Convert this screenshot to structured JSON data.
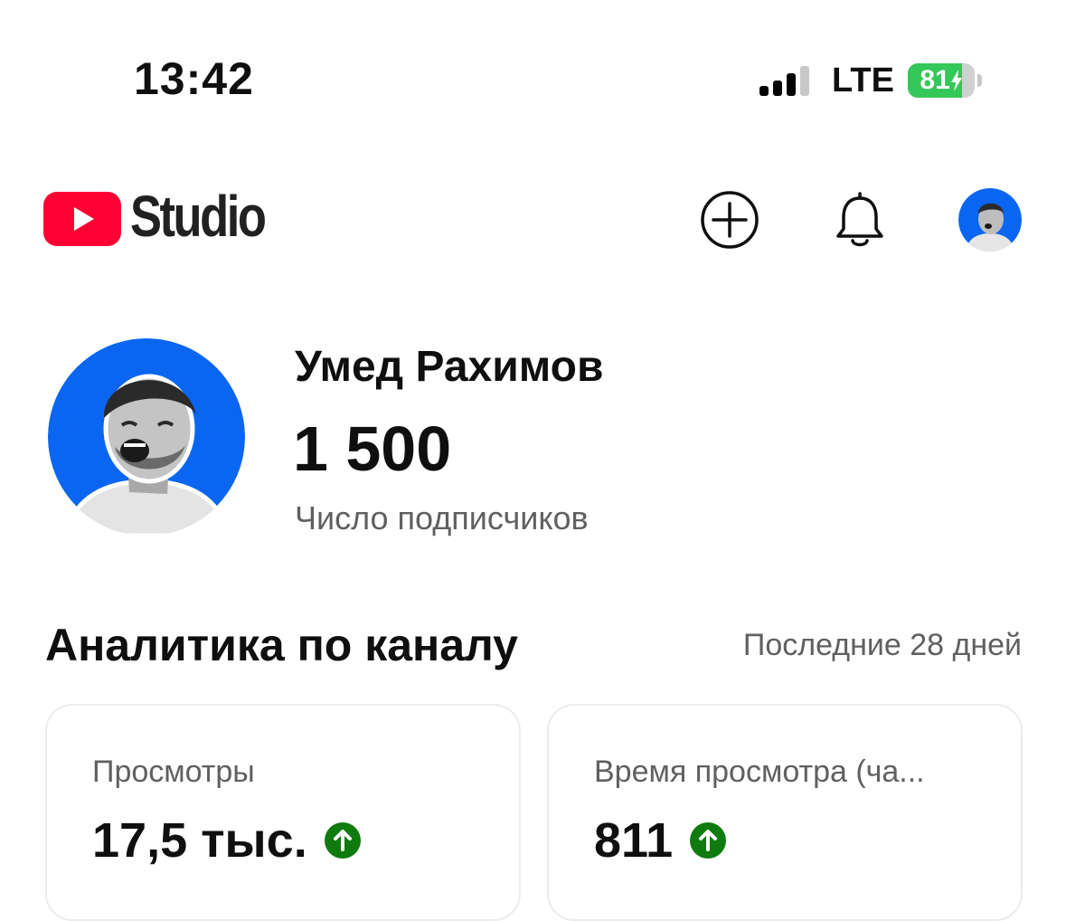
{
  "status_bar": {
    "time": "13:42",
    "network": "LTE",
    "battery_percent": "81",
    "battery_level": 0.81,
    "battery_color": "#34c759"
  },
  "header": {
    "logo_icon": "youtube-play-icon",
    "brand_text": "Studio",
    "logo_color": "#ff0033",
    "actions": [
      {
        "icon": "create-plus-icon"
      },
      {
        "icon": "bell-icon"
      },
      {
        "icon": "account-avatar"
      }
    ]
  },
  "channel": {
    "name": "Умед Рахимов",
    "subscriber_count": "1 500",
    "subscriber_label": "Число подписчиков",
    "avatar_bg": "#0a66f0"
  },
  "analytics": {
    "title": "Аналитика по каналу",
    "period": "Последние 28 дней",
    "cards": [
      {
        "label": "Просмотры",
        "value": "17,5 тыс.",
        "trend_icon": "arrow-up-circle-icon"
      },
      {
        "label": "Время просмотра (ча...",
        "value": "811",
        "trend_icon": "arrow-up-circle-icon"
      }
    ],
    "trend_color": "#0f7b0f"
  }
}
